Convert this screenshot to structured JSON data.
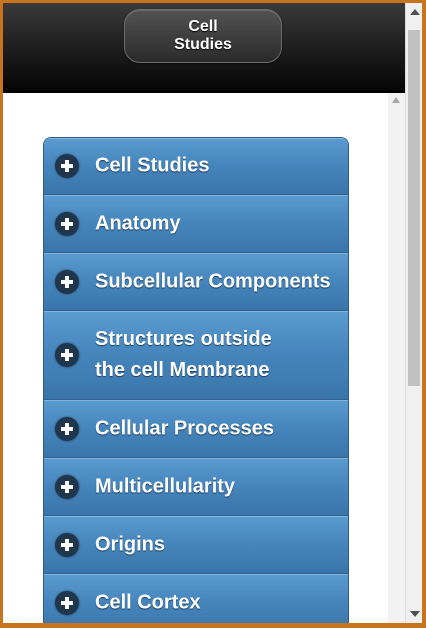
{
  "header": {
    "title": "Cell\nStudies"
  },
  "menu": {
    "items": [
      {
        "label": "Cell Studies",
        "icon": "plus-circle-icon"
      },
      {
        "label": "Anatomy",
        "icon": "plus-circle-icon"
      },
      {
        "label": "Subcellular Components",
        "icon": "plus-circle-icon"
      },
      {
        "label": "Structures outside\nthe cell Membrane",
        "icon": "plus-circle-icon"
      },
      {
        "label": "Cellular Processes",
        "icon": "plus-circle-icon"
      },
      {
        "label": "Multicellularity",
        "icon": "plus-circle-icon"
      },
      {
        "label": "Origins",
        "icon": "plus-circle-icon"
      },
      {
        "label": "Cell Cortex",
        "icon": "plus-circle-icon"
      }
    ]
  },
  "colors": {
    "frame": "#c8741c",
    "header": "#1c1c1c",
    "menu_item": "#4585bc",
    "icon": "#20364d"
  }
}
